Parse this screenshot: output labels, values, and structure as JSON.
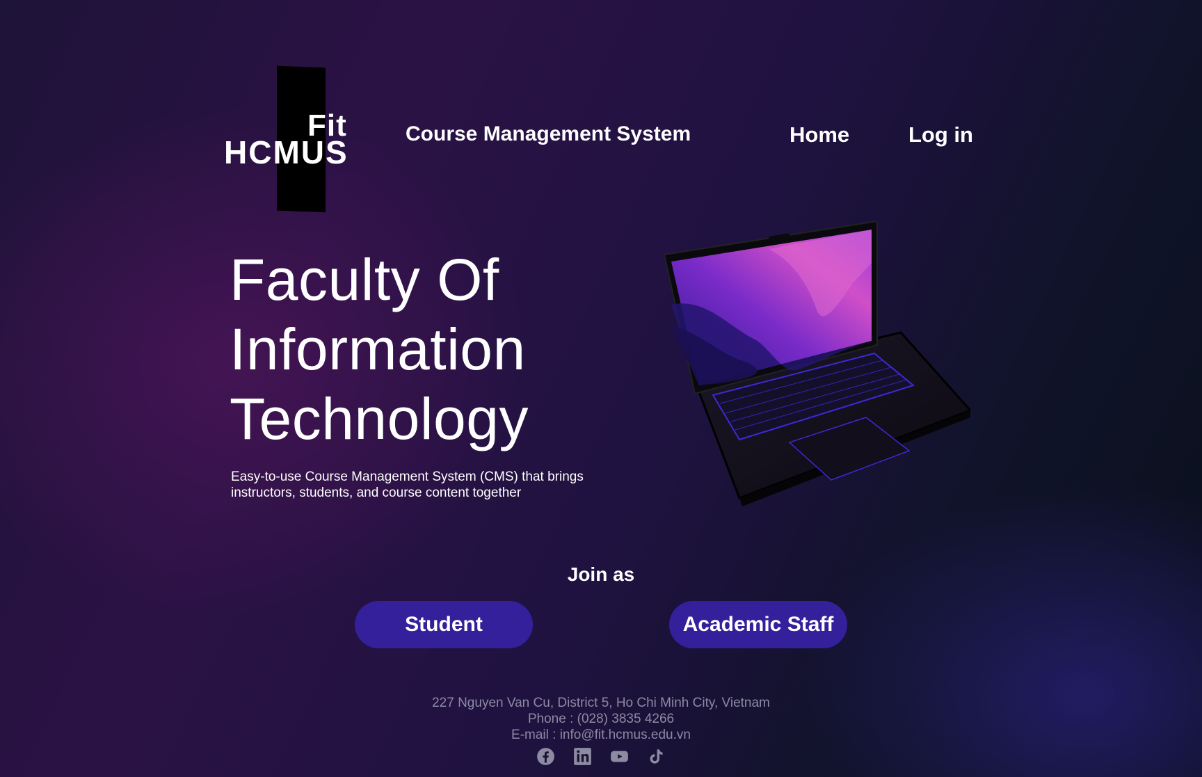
{
  "header": {
    "logo": {
      "text_top": "Fit",
      "text_main": "HCMUS"
    },
    "site_title": "Course Management System",
    "nav": [
      {
        "label": "Home"
      },
      {
        "label": "Log in"
      }
    ]
  },
  "hero": {
    "title_lines": [
      "Faculty Of",
      "Information",
      "Technology"
    ],
    "description": "Easy-to-use Course Management System (CMS) that brings instructors, students, and course content together",
    "image": "laptop-illustration"
  },
  "join": {
    "label": "Join as",
    "buttons": [
      {
        "label": "Student"
      },
      {
        "label": "Academic Staff"
      }
    ]
  },
  "footer": {
    "address": "227 Nguyen Van Cu, District 5, Ho Chi Minh City, Vietnam",
    "phone": "Phone : (028) 3835 4266",
    "email": "E-mail : info@fit.hcmus.edu.vn",
    "social": [
      "facebook-icon",
      "linkedin-icon",
      "youtube-icon",
      "tiktok-icon"
    ]
  },
  "colors": {
    "button_bg": "#33209a",
    "footer_text": "#8d8aa4",
    "background_dark": "#0a0f1c",
    "background_purple": "#2b1245"
  }
}
